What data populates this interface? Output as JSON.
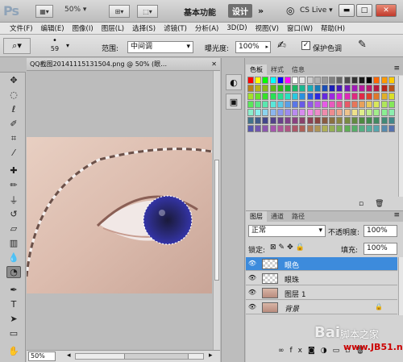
{
  "app": {
    "logo": "Ps",
    "zoom": "50%",
    "workspace_label": "基本功能",
    "workspace_design": "设计",
    "cs_live": "CS Live"
  },
  "window_buttons": {
    "minimize": "▬",
    "restore": "□",
    "close": "✕"
  },
  "menu": [
    "文件(F)",
    "编辑(E)",
    "图像(I)",
    "图层(L)",
    "选择(S)",
    "滤镜(T)",
    "分析(A)",
    "3D(D)",
    "视图(V)",
    "窗口(W)",
    "帮助(H)"
  ],
  "options": {
    "brush_size": "59",
    "range_label": "范围:",
    "range_value": "中间调",
    "exposure_label": "曝光度:",
    "exposure_value": "100%",
    "protect_tones_label": "保护色调",
    "protect_tones_checked": true
  },
  "document": {
    "tab_title": "QQ截图20141115131504.png @ 50% (眼…",
    "zoom_status": "50%"
  },
  "panels": {
    "swatch_tabs": [
      "色板",
      "样式",
      "信息"
    ],
    "layer_tabs": [
      "图层",
      "通道",
      "路径"
    ],
    "blend_mode": "正常",
    "opacity_label": "不透明度:",
    "opacity_value": "100%",
    "lock_label": "锁定:",
    "fill_label": "填充:",
    "fill_value": "100%"
  },
  "layers": [
    {
      "name": "眼色",
      "selected": true,
      "locked": false
    },
    {
      "name": "眼珠",
      "selected": false,
      "locked": false
    },
    {
      "name": "图层 1",
      "selected": false,
      "locked": false
    },
    {
      "name": "背景",
      "selected": false,
      "locked": true
    }
  ],
  "watermark": {
    "brand": "Bai",
    "site": "脚本之家",
    "url": "www.JB51.net"
  },
  "icons": {
    "eye": "eye-icon",
    "lock": "lock-icon"
  }
}
